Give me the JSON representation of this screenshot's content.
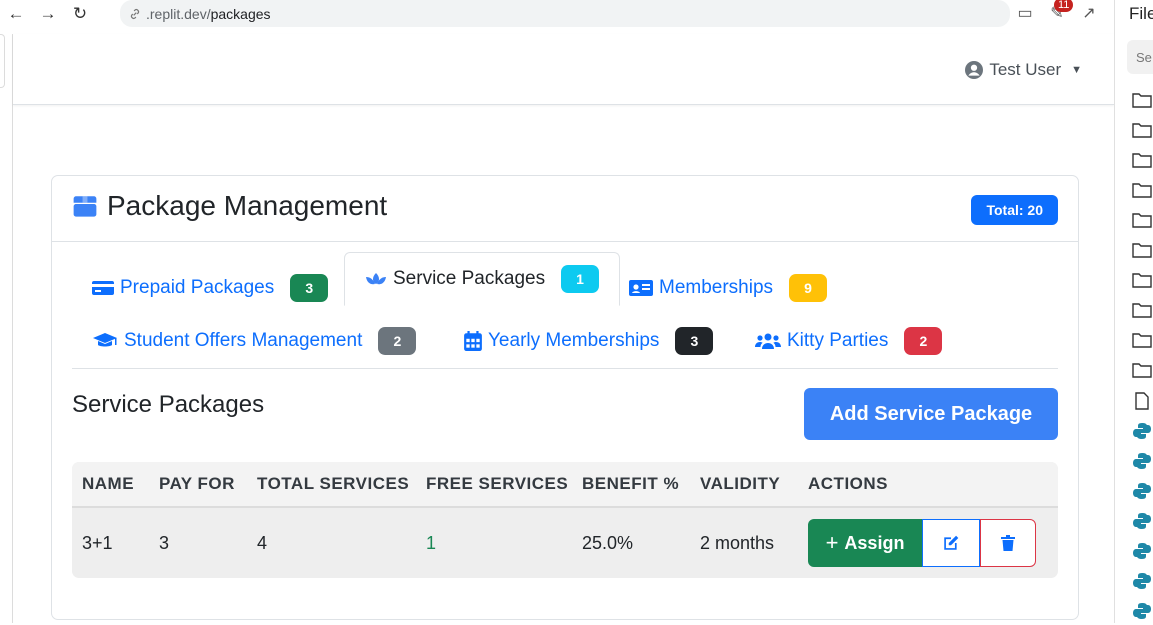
{
  "browser": {
    "url_prefix": ".replit.dev/",
    "url_path": "packages",
    "notification_count": "11"
  },
  "header": {
    "user_name": "Test User"
  },
  "card": {
    "title": "Package Management",
    "total_badge": "Total: 20"
  },
  "tabs": [
    {
      "label": "Prepaid Packages",
      "count": "3",
      "color": "#198754",
      "icon": "credit-card-icon"
    },
    {
      "label": "Service Packages",
      "count": "1",
      "color": "#0dcaf0",
      "icon": "spa-icon",
      "active": true
    },
    {
      "label": "Memberships",
      "count": "9",
      "color": "#ffc107",
      "icon": "id-card-icon"
    },
    {
      "label": "Student Offers Management",
      "count": "2",
      "color": "#6c757d",
      "icon": "graduation-cap-icon"
    },
    {
      "label": "Yearly Memberships",
      "count": "3",
      "color": "#212529",
      "icon": "calendar-icon"
    },
    {
      "label": "Kitty Parties",
      "count": "2",
      "color": "#dc3545",
      "icon": "users-icon"
    }
  ],
  "section": {
    "title": "Service Packages",
    "add_button": "Add Service Package"
  },
  "table": {
    "headers": [
      "NAME",
      "PAY FOR",
      "TOTAL SERVICES",
      "FREE SERVICES",
      "BENEFIT %",
      "VALIDITY",
      "ACTIONS"
    ],
    "rows": [
      {
        "name": "3+1",
        "pay_for": "3",
        "total_services": "4",
        "free_services": "1",
        "benefit": "25.0%",
        "validity": "2 months"
      }
    ],
    "assign_label": "Assign"
  },
  "right_panel": {
    "title": "Files",
    "search_placeholder": "Se"
  }
}
